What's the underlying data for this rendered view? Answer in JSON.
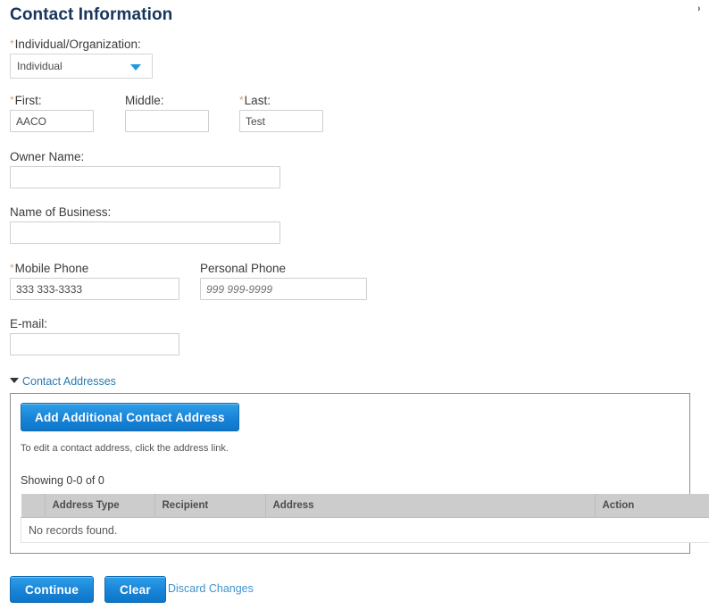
{
  "page": {
    "title": "Contact Information",
    "corner_glyph": "?"
  },
  "form": {
    "individual_organization": {
      "label": "Individual/Organization:",
      "required": true,
      "selected": "Individual",
      "caret_icon": "chevron-down-icon"
    },
    "first": {
      "label": "First:",
      "required": true,
      "value": "AACO"
    },
    "middle": {
      "label": "Middle:",
      "required": false,
      "value": ""
    },
    "last": {
      "label": "Last:",
      "required": true,
      "value": "Test"
    },
    "owner_name": {
      "label": "Owner Name:",
      "required": false,
      "value": ""
    },
    "name_of_business": {
      "label": "Name of Business:",
      "required": false,
      "value": ""
    },
    "mobile_phone": {
      "label": "Mobile Phone",
      "required": true,
      "value": "333 333-3333"
    },
    "personal_phone": {
      "label": "Personal Phone",
      "required": false,
      "value": "",
      "placeholder": "999 999-9999"
    },
    "email": {
      "label": "E-mail:",
      "required": false,
      "value": ""
    },
    "required_marker": "*"
  },
  "contact_addresses": {
    "disclosure_label": "Contact Addresses",
    "expanded": true,
    "add_button": "Add Additional Contact Address",
    "hint": "To edit a contact address, click the address link.",
    "showing": "Showing 0-0 of 0",
    "table": {
      "columns": [
        "",
        "Address Type",
        "Recipient",
        "Address",
        "Action"
      ],
      "rows": [],
      "empty_message": "No records found."
    }
  },
  "footer": {
    "continue_label": "Continue",
    "clear_label": "Clear",
    "discard_label": "Discard Changes"
  },
  "colors": {
    "title": "#17355d",
    "link": "#2a7ab0",
    "button": "#1a86d9",
    "required": "#e0a06a",
    "table_header": "#cccccc"
  }
}
